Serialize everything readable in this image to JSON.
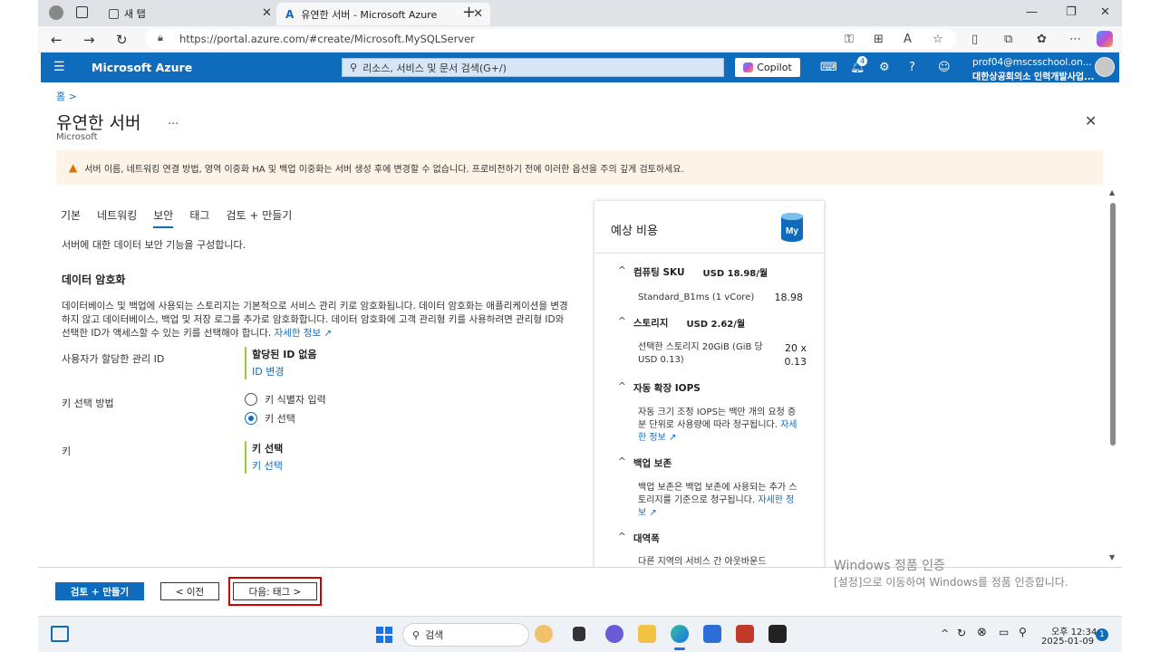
{
  "browser": {
    "tabs": [
      {
        "label": "새 탭",
        "active": false
      },
      {
        "label": "유연한 서버 - Microsoft Azure",
        "active": true
      }
    ],
    "new_tab_glyph": "+",
    "url": "https://portal.azure.com/#create/Microsoft.MySQLServer"
  },
  "azure_header": {
    "brand": "Microsoft Azure",
    "search_placeholder": "리소스, 서비스 및 문서 검색(G+/)",
    "copilot_label": "Copilot",
    "notification_count": "4",
    "account_email": "prof04@mscsschool.on...",
    "account_org": "대한상공회의소 인력개발사업..."
  },
  "page": {
    "breadcrumb": "홈 >",
    "title": "유연한 서버",
    "more": "...",
    "subtitle": "Microsoft",
    "warning": "서버 이름, 네트워킹 연결 방법, 영역 이중화 HA 및 백업 이중화는 서버 생성 후에 변경할 수 없습니다. 프로비전하기 전에 이러한 옵션을 주의 깊게 검토하세요."
  },
  "wizard_tabs": [
    {
      "label": "기본",
      "active": false
    },
    {
      "label": "네트워킹",
      "active": false
    },
    {
      "label": "보안",
      "active": true
    },
    {
      "label": "태그",
      "active": false
    },
    {
      "label": "검토 + 만들기",
      "active": false
    }
  ],
  "security": {
    "description": "서버에 대한 데이터 보안 기능을 구성합니다.",
    "section_title": "데이터 암호화",
    "paragraph": "데이터베이스 및 백업에 사용되는 스토리지는 기본적으로 서비스 관리 키로 암호화됩니다. 데이터 암호화는 애플리케이션을 변경하지 않고 데이터베이스, 백업 및 저장 로그를 추가로 암호화합니다. 데이터 암호화에 고객 관리형 키를 사용하려면 관리형 ID와 선택한 ID가 액세스할 수 있는 키를 선택해야 합니다.",
    "learn_more": "자세한 정보",
    "managed_identity_label": "사용자가 할당한 관리 ID",
    "managed_identity_value": "할당된 ID 없음",
    "managed_identity_link": "ID 변경",
    "key_method_label": "키 선택 방법",
    "key_method_options": [
      {
        "label": "키 식별자 입력",
        "selected": false
      },
      {
        "label": "키 선택",
        "selected": true
      }
    ],
    "key_label": "키",
    "key_value": "키 선택",
    "key_link": "키 선택"
  },
  "cost_panel": {
    "title": "예상 비용",
    "icon_text": "My",
    "sections": [
      {
        "title": "컴퓨팅 SKU",
        "amount": "USD 18.98/월",
        "detail": "Standard_B1ms (1 vCore)",
        "value": "18.98"
      },
      {
        "title": "스토리지",
        "amount": "USD 2.62/월",
        "detail": "선택한 스토리지 20GiB (GiB 당 USD 0.13)",
        "value": "20 x 0.13"
      },
      {
        "title": "자동 확장 IOPS",
        "amount": "",
        "detail": "자동 크기 조정 IOPS는 백만 개의 요청 증분 단위로 사용량에 따라 청구됩니다.",
        "link": "자세한 정보"
      },
      {
        "title": "백업 보존",
        "amount": "",
        "detail": "백업 보존은 백업 보존에 사용되는 추가 스토리지를 기준으로 청구됩니다.",
        "link": "자세한 정보"
      },
      {
        "title": "대역폭",
        "amount": "",
        "detail": "다른 지역의 서비스 간 아웃바운드"
      }
    ]
  },
  "footer": {
    "review_create": "검토 + 만들기",
    "previous": "< 이전",
    "next": "다음: 태그 >"
  },
  "watermark": {
    "line1": "Windows 정품 인증",
    "line2": "[설정]으로 이동하여 Windows를 정품 인증합니다."
  },
  "taskbar": {
    "search_label": "검색",
    "time": "오후 12:34",
    "date": "2025-01-09",
    "badge": "1"
  },
  "colors": {
    "azure_blue": "#0f6cbd",
    "warning_bg": "#fdf3e6",
    "highlight_red": "#d00000",
    "field_accent": "#a4c639"
  }
}
